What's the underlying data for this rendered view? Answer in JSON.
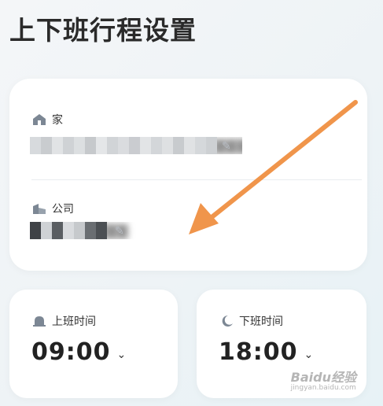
{
  "page": {
    "title": "上下班行程设置"
  },
  "route": {
    "home": {
      "label": "家",
      "icon": "home-icon",
      "address": "▇▇▇▇▇▇▇▇▇▇▇▇▇▇▇▇▇▇▇▇"
    },
    "company": {
      "label": "公司",
      "icon": "building-icon",
      "address": "▇▇▇▇▇▇▇▇▇"
    }
  },
  "commute": {
    "start": {
      "label": "上班时间",
      "icon": "bell-icon",
      "value": "09:00"
    },
    "end": {
      "label": "下班时间",
      "icon": "moon-icon",
      "value": "18:00"
    }
  },
  "annotation": {
    "color": "#f0954b"
  },
  "watermark": {
    "text": "Baidu经验",
    "sub": "jingyan.baidu.com"
  }
}
